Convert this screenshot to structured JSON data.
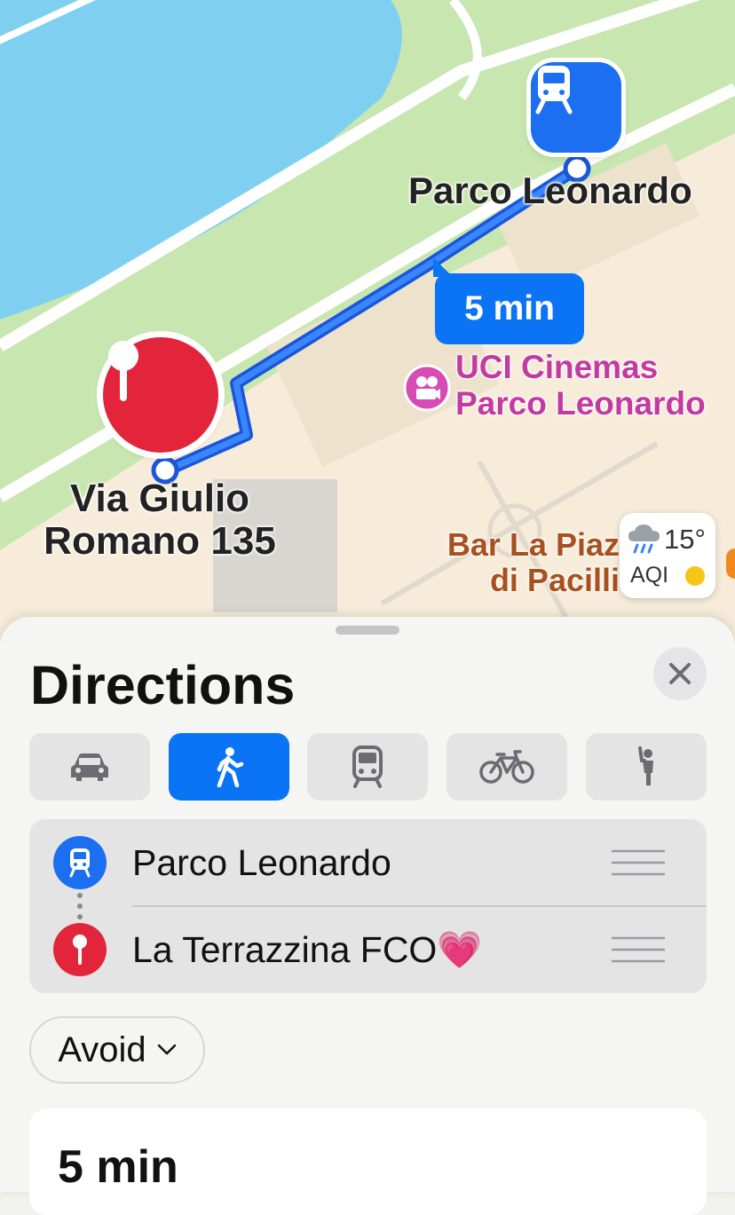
{
  "map": {
    "station_label": "Parco Leonardo",
    "destination_label_line1": "Via Giulio",
    "destination_label_line2": "Romano 135",
    "route_eta": "5 min",
    "poi_cinema_line1": "UCI Cinemas",
    "poi_cinema_line2": "Parco Leonardo",
    "poi_bar_line1": "Bar La Piaz",
    "poi_bar_line2": "di Pacilli",
    "weather": {
      "temperature": "15°",
      "aqi_label": "AQI",
      "icon": "rain-cloud-icon"
    },
    "colors": {
      "route": "#0a74f5",
      "water": "#7fd0f0",
      "park": "#c8e6b0",
      "ground": "#f6ecd9",
      "station_pin": "#1c6ff0",
      "destination_pin": "#e3253c"
    }
  },
  "sheet": {
    "title": "Directions",
    "close_icon": "close-icon",
    "modes": [
      {
        "name": "drive",
        "icon": "car-icon",
        "active": false
      },
      {
        "name": "walk",
        "icon": "walking-icon",
        "active": true
      },
      {
        "name": "transit",
        "icon": "train-icon",
        "active": false
      },
      {
        "name": "cycle",
        "icon": "bicycle-icon",
        "active": false
      },
      {
        "name": "ride",
        "icon": "ride-share-icon",
        "active": false
      }
    ],
    "stops": [
      {
        "label": "Parco Leonardo",
        "icon": "train-icon"
      },
      {
        "label": "La Terrazzina FCO💗",
        "icon": "pin-icon"
      }
    ],
    "avoid_label": "Avoid",
    "route_time": "5 min"
  }
}
